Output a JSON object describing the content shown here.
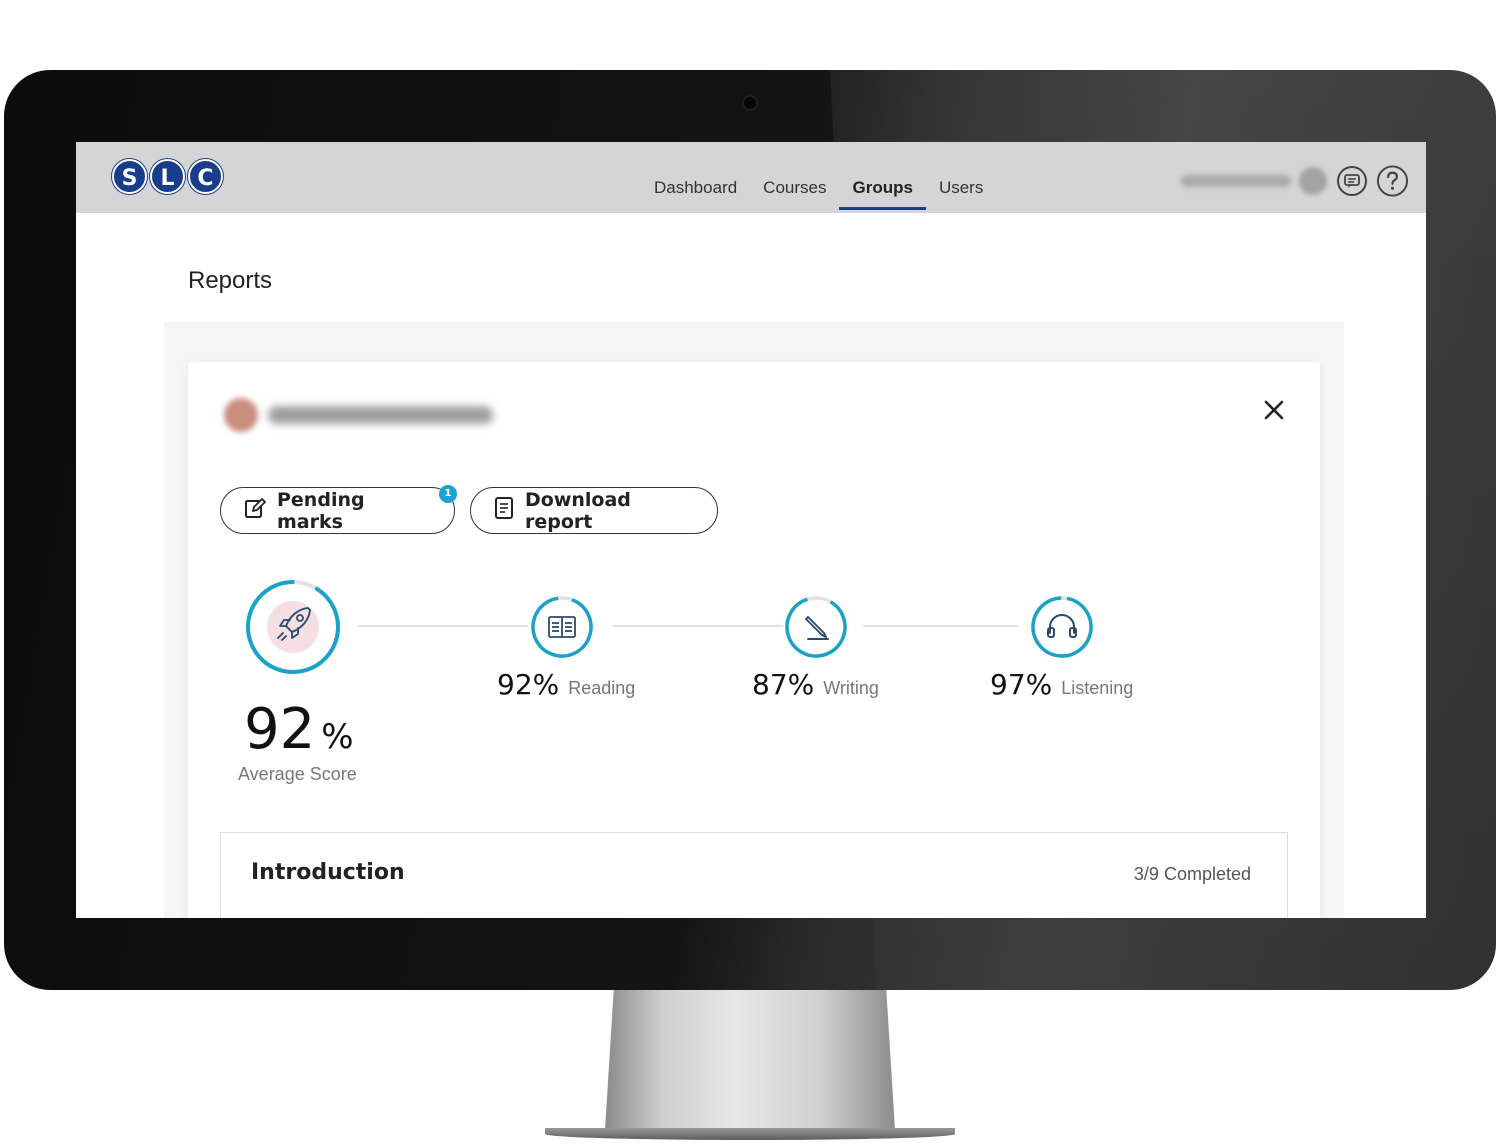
{
  "brand": {
    "logo_letters": [
      "S",
      "L",
      "C"
    ],
    "color": "#173d8c"
  },
  "nav": {
    "items": [
      {
        "label": "Dashboard",
        "active": false
      },
      {
        "label": "Courses",
        "active": false
      },
      {
        "label": "Groups",
        "active": true
      },
      {
        "label": "Users",
        "active": false
      }
    ]
  },
  "header_icons": [
    "chat-icon",
    "help-icon"
  ],
  "page": {
    "title": "Reports"
  },
  "report": {
    "pending_label": "Pending marks",
    "pending_count": "1",
    "download_label": "Download report",
    "average": {
      "value": "92",
      "unit": "%",
      "label": "Average Score",
      "icon": "rocket-icon"
    },
    "skills": [
      {
        "value": "92%",
        "label": "Reading",
        "icon": "book-icon"
      },
      {
        "value": "87%",
        "label": "Writing",
        "icon": "pen-icon"
      },
      {
        "value": "97%",
        "label": "Listening",
        "icon": "headphones-icon"
      }
    ],
    "accent": "#1aa3c7"
  },
  "module": {
    "title": "Introduction",
    "progress": "3/9 Completed"
  }
}
